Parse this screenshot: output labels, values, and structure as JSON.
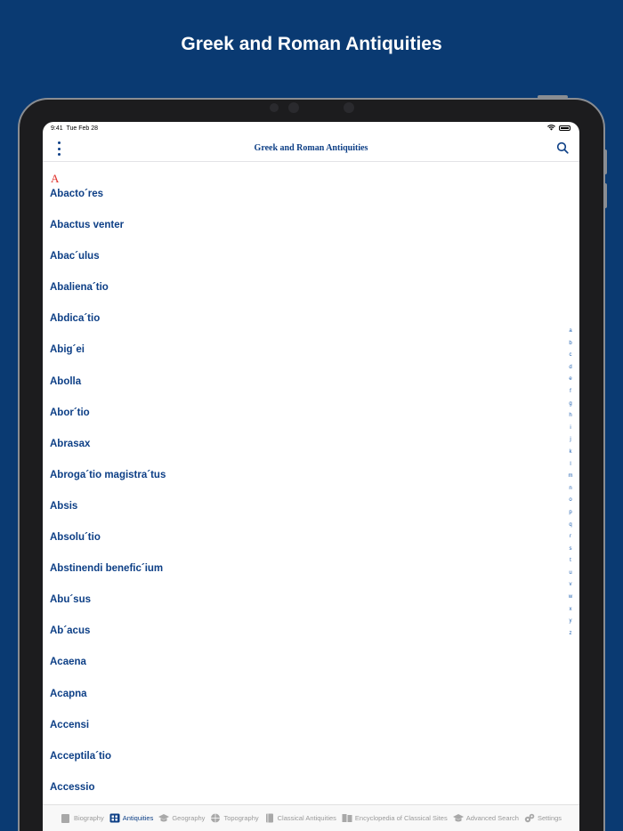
{
  "promo": {
    "title": "Greek and Roman Antiquities"
  },
  "status": {
    "time": "9:41",
    "date": "Tue Feb 28"
  },
  "navbar": {
    "title": "Greek and Roman Antiquities"
  },
  "list": {
    "section": "A",
    "items": [
      "Abacto´res",
      "Abactus venter",
      "Abac´ulus",
      "Abaliena´tio",
      "Abdica´tio",
      "Abig´ei",
      "Abolla",
      "Abor´tio",
      "Abrasax",
      "Abroga´tio magistra´tus",
      "Absis",
      "Absolu´tio",
      "Abstinendi benefic´ium",
      "Abu´sus",
      "Ab´acus",
      "Acaena",
      "Acapna",
      "Accensi",
      "Acceptila´tio",
      "Accessio"
    ]
  },
  "index": [
    "a",
    "b",
    "c",
    "d",
    "e",
    "f",
    "g",
    "h",
    "i",
    "j",
    "k",
    "l",
    "m",
    "n",
    "o",
    "p",
    "q",
    "r",
    "s",
    "t",
    "u",
    "v",
    "w",
    "x",
    "y",
    "z"
  ],
  "tabs": [
    {
      "label": "Biography",
      "icon": "book-icon",
      "active": false
    },
    {
      "label": "Antiquities",
      "icon": "grid-book-icon",
      "active": true
    },
    {
      "label": "Geography",
      "icon": "graduation-cap-icon",
      "active": false
    },
    {
      "label": "Topography",
      "icon": "globe-icon",
      "active": false
    },
    {
      "label": "Classical Antiquities",
      "icon": "book-closed-icon",
      "active": false
    },
    {
      "label": "Encyclopedia of Classical Sites",
      "icon": "books-icon",
      "active": false
    },
    {
      "label": "Advanced Search",
      "icon": "cap-search-icon",
      "active": false
    },
    {
      "label": "Settings",
      "icon": "gears-icon",
      "active": false
    }
  ],
  "colors": {
    "background": "#0a3a72",
    "accent": "#0d3f86",
    "section": "#e0302a"
  }
}
